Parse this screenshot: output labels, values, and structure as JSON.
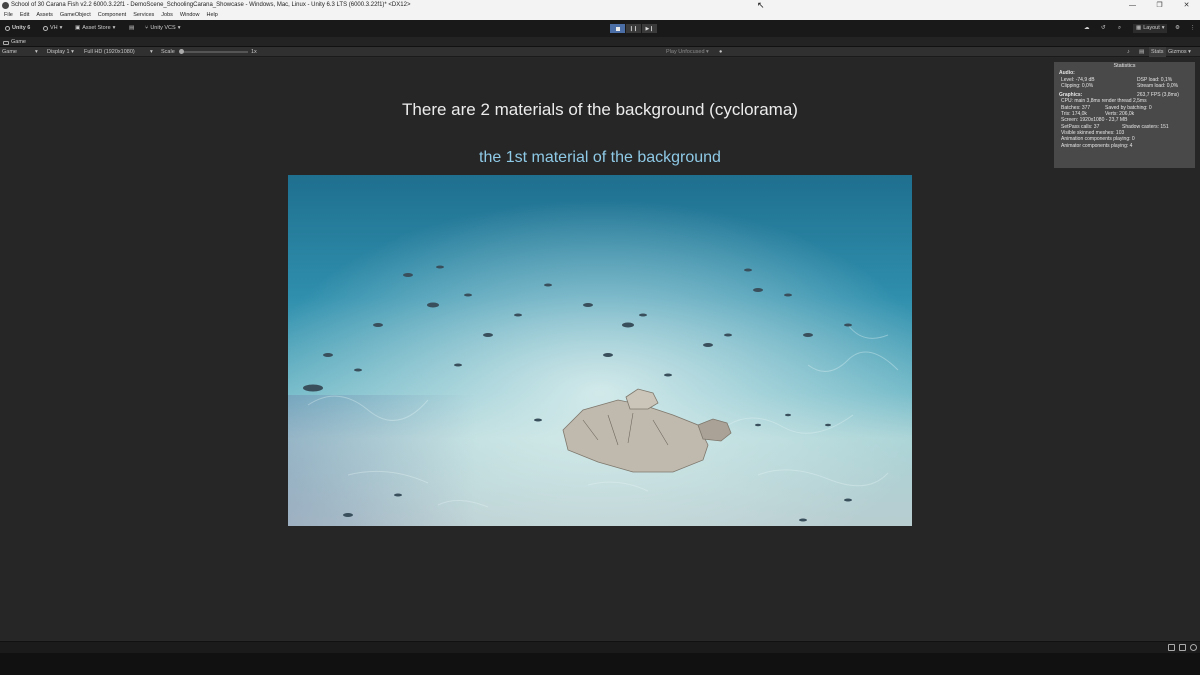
{
  "window": {
    "title": "School of 30 Carana Fish v2.2 6000.3.22f1 - DemoScene_SchoolingCarana_Showcase - Windows, Mac, Linux - Unity 6.3 LTS (6000.3.22f1)* <DX12>",
    "controls": [
      "minimize",
      "maximize",
      "close"
    ]
  },
  "menu": [
    "File",
    "Edit",
    "Assets",
    "GameObject",
    "Component",
    "Services",
    "Jobs",
    "Window",
    "Help"
  ],
  "toolbar": {
    "unity_label": "Unity 6",
    "account_label": "VH",
    "asset_store_label": "Asset Store",
    "vcs_label": "Unity VCS",
    "layout_label": "Layout",
    "icons": [
      "unity-logo-icon",
      "account-icon",
      "asset-store-icon",
      "package-icon",
      "vcs-icon",
      "cloud-icon",
      "history-icon",
      "search-icon",
      "help-icon",
      "more-icon"
    ]
  },
  "tab": {
    "label": "Game"
  },
  "gamebar": {
    "view_select": "Game",
    "display_select": "Display 1",
    "resolution_select": "Full HD (1920x1080)",
    "scale_label": "Scale",
    "scale_value": "1x",
    "play_focus_select": "Play Unfocused",
    "stats_label": "Stats",
    "gizmos_label": "Gizmos"
  },
  "game": {
    "heading": "There are 2 materials of the background (cyclorama)",
    "subheading": "the 1st material of the background",
    "scene_description_icon": "underwater-scene"
  },
  "statistics": {
    "title": "Statistics",
    "audio_label": "Audio:",
    "level": "Level: -74,9 dB",
    "dsp_load": "DSP load: 0,1%",
    "clipping": "Clipping: 0,0%",
    "stream_load": "Stream load: 0,0%",
    "graphics_label": "Graphics:",
    "fps": "263,7 FPS (3,8ms)",
    "cpu": "CPU: main 3,8ms  render thread 2,5ms",
    "batches": "Batches: 377",
    "saved_by_batching": "Saved by batching: 0",
    "tris": "Tris: 174,0k",
    "verts": "Verts: 206,0k",
    "screen": "Screen: 1920x1080 - 23,7 MB",
    "setpass": "SetPass calls: 37",
    "shadow_casters": "Shadow casters: 151",
    "skinned_meshes": "Visible skinned meshes: 103",
    "animation_components": "Animation components playing: 0",
    "animator_components": "Animator components playing: 4"
  }
}
